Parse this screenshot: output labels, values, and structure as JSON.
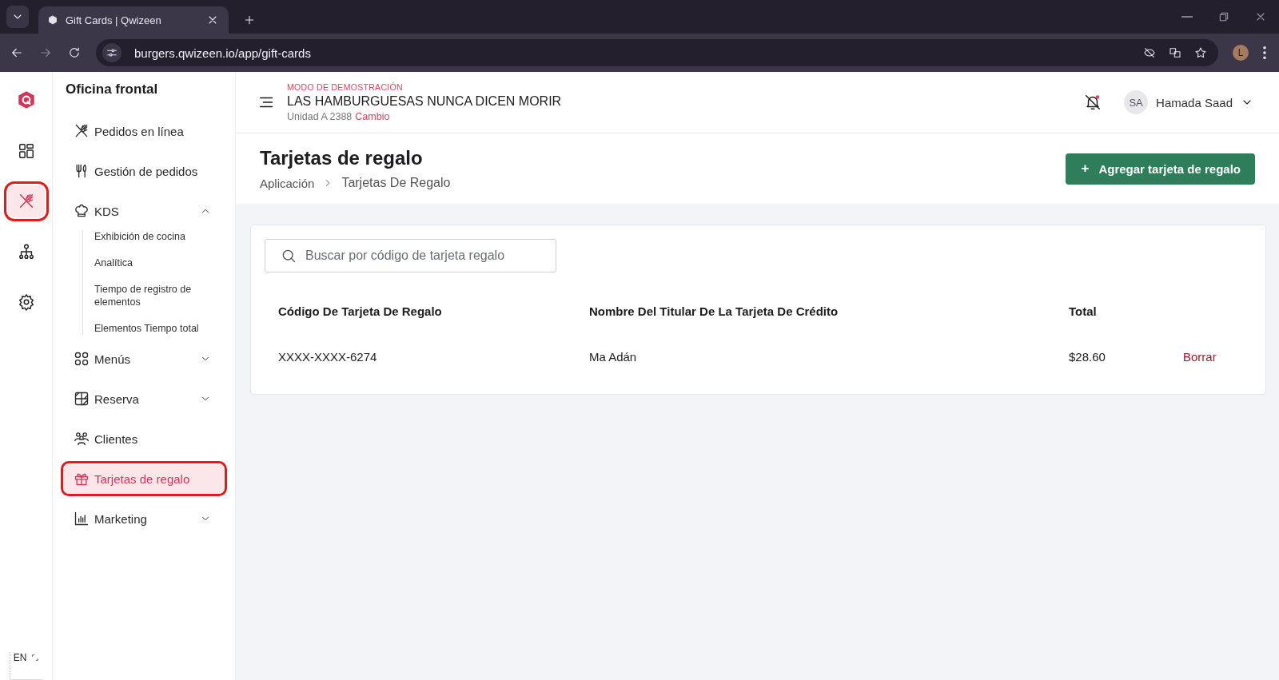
{
  "browser": {
    "tab_title": "Gift Cards | Qwizeen",
    "url": "burgers.qwizeen.io/app/gift-cards",
    "profile_initial": "L"
  },
  "rail": {
    "items": [
      {
        "kind": "dashboard",
        "selected": false,
        "annotated": false
      },
      {
        "kind": "utensils",
        "selected": true,
        "annotated": true
      },
      {
        "kind": "hierarchy",
        "selected": false,
        "annotated": false
      },
      {
        "kind": "gear",
        "selected": false,
        "annotated": false
      }
    ],
    "language": "EN"
  },
  "sidebar": {
    "title": "Oficina frontal",
    "items": [
      {
        "label": "Pedidos en línea",
        "kind": "utensils",
        "selected": false,
        "annotated": false
      },
      {
        "label": "Gestión de pedidos",
        "kind": "fork",
        "selected": false,
        "annotated": false
      },
      {
        "label": "KDS",
        "kind": "chef",
        "selected": false,
        "annotated": false,
        "expanded": true,
        "children": [
          {
            "label": "Exhibición de cocina"
          },
          {
            "label": "Analítica"
          },
          {
            "label": "Tiempo de registro de elementos"
          },
          {
            "label": "Elementos Tiempo total"
          }
        ]
      },
      {
        "label": "Menús",
        "kind": "grid",
        "selected": false,
        "annotated": false,
        "expanded": false
      },
      {
        "label": "Reserva",
        "kind": "table",
        "selected": false,
        "annotated": false,
        "expanded": false
      },
      {
        "label": "Clientes",
        "kind": "people",
        "selected": false,
        "annotated": false
      },
      {
        "label": "Tarjetas de regalo",
        "kind": "gift",
        "selected": true,
        "annotated": true
      },
      {
        "label": "Marketing",
        "kind": "chart",
        "selected": false,
        "annotated": false,
        "expanded": false
      }
    ]
  },
  "header": {
    "mode": "MODO DE DEMOSTRACIÓN",
    "restaurant": "LAS HAMBURGUESAS NUNCA DICEN MORIR",
    "unit": "Unidad A 2388",
    "change_link": "Cambio",
    "user_initials": "SA",
    "user_name": "Hamada Saad"
  },
  "page": {
    "title": "Tarjetas de regalo",
    "breadcrumb": [
      "Aplicación",
      "Tarjetas De Regalo"
    ],
    "add_button": "Agregar tarjeta de regalo",
    "add_button_icon": "+"
  },
  "search": {
    "placeholder": "Buscar por código de tarjeta regalo"
  },
  "table": {
    "columns": [
      "Código De Tarjeta De Regalo",
      "Nombre Del Titular De La Tarjeta De Crédito",
      "Total"
    ],
    "rows": [
      {
        "cells": [
          "XXXX-XXXX-6274",
          "Ma Adán",
          "$28.60"
        ],
        "action": "Borrar"
      }
    ]
  }
}
